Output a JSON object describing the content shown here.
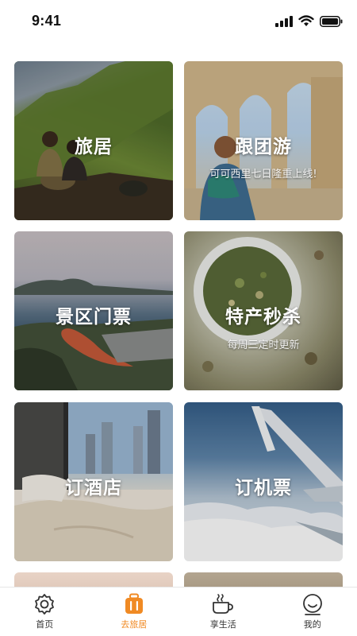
{
  "status": {
    "time": "9:41"
  },
  "cards": [
    {
      "title": "旅居",
      "subtitle": ""
    },
    {
      "title": "跟团游",
      "subtitle": "可可西里七日隆重上线!"
    },
    {
      "title": "景区门票",
      "subtitle": ""
    },
    {
      "title": "特产秒杀",
      "subtitle": "每周三定时更新"
    },
    {
      "title": "订酒店",
      "subtitle": ""
    },
    {
      "title": "订机票",
      "subtitle": ""
    }
  ],
  "tabs": [
    {
      "label": "首页",
      "icon": "gear-icon"
    },
    {
      "label": "去旅居",
      "icon": "suitcase-icon"
    },
    {
      "label": "享生活",
      "icon": "coffee-cup-icon"
    },
    {
      "label": "我的",
      "icon": "smiley-icon"
    }
  ],
  "colors": {
    "accent": "#f08a24",
    "tab_text": "#333333"
  }
}
